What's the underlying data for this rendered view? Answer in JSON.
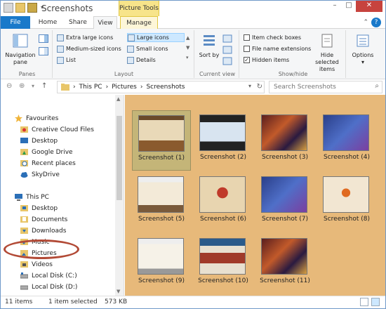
{
  "window": {
    "title": "Screenshots",
    "context_tab_group": "Picture Tools",
    "controls": {
      "minimize": "–",
      "maximize": "□",
      "close": "✕"
    }
  },
  "tabs": [
    "File",
    "Home",
    "Share",
    "View",
    "Manage"
  ],
  "ribbon": {
    "panes": {
      "navigation_pane": "Navigation pane",
      "label": "Panes"
    },
    "layout": {
      "items": [
        "Extra large icons",
        "Large icons",
        "Medium-sized icons",
        "Small icons",
        "List",
        "Details"
      ],
      "selected": "Large icons",
      "label": "Layout"
    },
    "current_view": {
      "sort_by": "Sort by",
      "label": "Current view"
    },
    "show_hide": {
      "item_check_boxes": "Item check boxes",
      "file_name_extensions": "File name extensions",
      "hidden_items": "Hidden items",
      "hidden_items_checked": true,
      "hide_selected_items": "Hide selected items",
      "label": "Show/hide"
    },
    "options": "Options"
  },
  "address": {
    "crumbs": [
      "This PC",
      "Pictures",
      "Screenshots"
    ],
    "search_placeholder": "Search Screenshots"
  },
  "nav": {
    "favourites_header": "Favourites",
    "favourites": [
      "Creative Cloud Files",
      "Desktop",
      "Google Drive",
      "Recent places",
      "SkyDrive"
    ],
    "thispc_header": "This PC",
    "thispc": [
      "Desktop",
      "Documents",
      "Downloads",
      "Music",
      "Pictures",
      "Videos",
      "Local Disk (C:)",
      "Local Disk (D:)"
    ]
  },
  "files": [
    {
      "name": "Screenshot (1)",
      "selected": true
    },
    {
      "name": "Screenshot (2)",
      "selected": false
    },
    {
      "name": "Screenshot (3)",
      "selected": false
    },
    {
      "name": "Screenshot (4)",
      "selected": false
    },
    {
      "name": "Screenshot (5)",
      "selected": false
    },
    {
      "name": "Screenshot (6)",
      "selected": false
    },
    {
      "name": "Screenshot (7)",
      "selected": false
    },
    {
      "name": "Screenshot (8)",
      "selected": false
    },
    {
      "name": "Screenshot (9)",
      "selected": false
    },
    {
      "name": "Screenshot (10)",
      "selected": false
    },
    {
      "name": "Screenshot (11)",
      "selected": false
    }
  ],
  "status": {
    "items": "11 items",
    "selected": "1 item selected",
    "size": "573 KB"
  },
  "colors": {
    "accent": "#1979ca",
    "content_bg": "#e7b97a",
    "annotation_circle": "#b24a36"
  }
}
